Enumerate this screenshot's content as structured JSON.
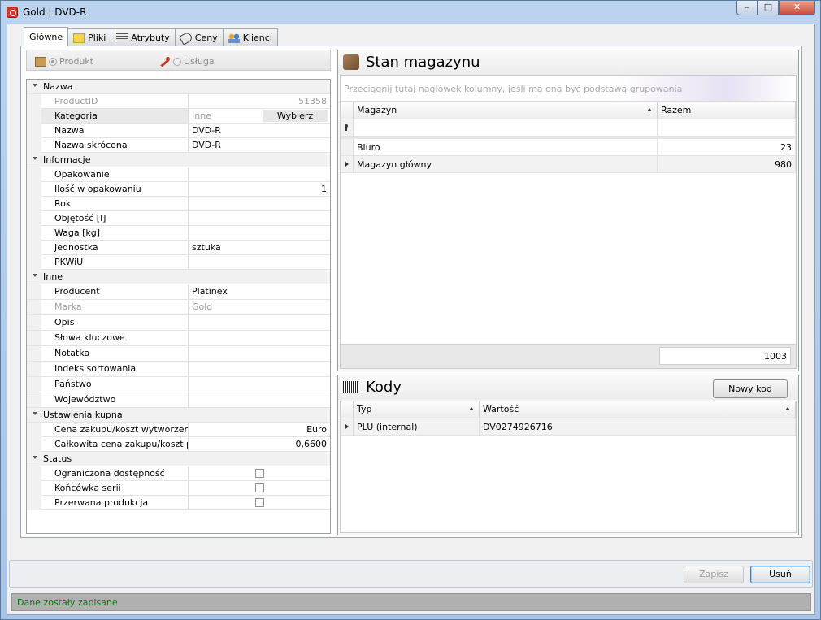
{
  "window": {
    "title": "Gold | DVD-R"
  },
  "tabs": [
    {
      "label": "Główne",
      "icon": "none"
    },
    {
      "label": "Pliki",
      "icon": "folder-icon"
    },
    {
      "label": "Atrybuty",
      "icon": "list-icon"
    },
    {
      "label": "Ceny",
      "icon": "tag-icon"
    },
    {
      "label": "Klienci",
      "icon": "people-icon"
    }
  ],
  "product_type": {
    "product_label": "Produkt",
    "service_label": "Usługa"
  },
  "properties": {
    "nazwa": {
      "title": "Nazwa",
      "productid_label": "ProductID",
      "productid_value": "51358",
      "kategoria_label": "Kategoria",
      "kategoria_value": "Inne",
      "wybierz_label": "Wybierz",
      "nazwa_label": "Nazwa",
      "nazwa_value": "DVD-R",
      "nazwa_skrocona_label": "Nazwa skrócona",
      "nazwa_skrocona_value": "DVD-R"
    },
    "informacje": {
      "title": "Informacje",
      "opakowanie_label": "Opakowanie",
      "opakowanie_value": "",
      "ilosc_label": "Ilość w opakowaniu",
      "ilosc_value": "1",
      "rok_label": "Rok",
      "rok_value": "",
      "objetosc_label": "Objętość [l]",
      "objetosc_value": "",
      "waga_label": "Waga [kg]",
      "waga_value": "",
      "jednostka_label": "Jednostka",
      "jednostka_value": "sztuka",
      "pkwiu_label": "PKWiU",
      "pkwiu_value": ""
    },
    "inne": {
      "title": "Inne",
      "producent_label": "Producent",
      "producent_value": "Platinex",
      "marka_label": "Marka",
      "marka_value": "Gold",
      "opis_label": "Opis",
      "opis_value": "",
      "slowa_label": "Słowa kluczowe",
      "slowa_value": "",
      "notatka_label": "Notatka",
      "notatka_value": "",
      "indeks_label": "Indeks sortowania",
      "indeks_value": "",
      "panstwo_label": "Państwo",
      "panstwo_value": "",
      "wojewodztwo_label": "Województwo",
      "wojewodztwo_value": ""
    },
    "ustawienia": {
      "title": "Ustawienia kupna",
      "cena_label": "Cena zakupu/koszt wytworzenia",
      "cena_value": "Euro",
      "calkowita_label": "Całkowita cena zakupu/koszt produkcji",
      "calkowita_value": "0,6600"
    },
    "status": {
      "title": "Status",
      "ograniczona_label": "Ograniczona dostępność",
      "ograniczona_checked": false,
      "koncowka_label": "Końcówka serii",
      "koncowka_checked": false,
      "przerwana_label": "Przerwana produkcja",
      "przerwana_checked": false
    }
  },
  "stock": {
    "title": "Stan magazynu",
    "group_hint": "Przeciągnij tutaj nagłówek kolumny, jeśli ma ona być podstawą grupowania",
    "columns": [
      "Magazyn",
      "Razem"
    ],
    "rows": [
      {
        "magazyn": "Biuro",
        "razem": "23"
      },
      {
        "magazyn": "Magazyn główny",
        "razem": "980"
      }
    ],
    "total": "1003"
  },
  "codes": {
    "title": "Kody",
    "new_button": "Nowy kod",
    "columns": [
      "Typ",
      "Wartość"
    ],
    "rows": [
      {
        "typ": "PLU (internal)",
        "wartosc": "DV0274926716"
      }
    ]
  },
  "footer": {
    "save_label": "Zapisz",
    "delete_label": "Usuń"
  },
  "status_bar": {
    "message": "Dane zostały zapisane"
  }
}
